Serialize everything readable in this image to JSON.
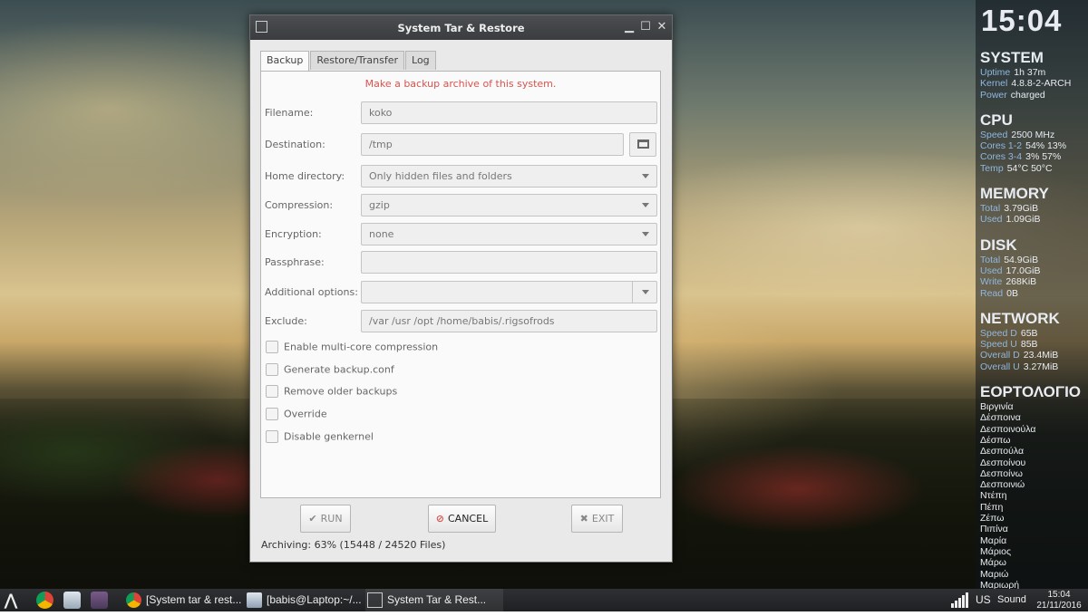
{
  "window": {
    "title": "System Tar & Restore",
    "controls": {
      "minimize": "▁",
      "maximize": "☐",
      "close": "✕"
    },
    "tabs": [
      "Backup",
      "Restore/Transfer",
      "Log"
    ],
    "active_tab": "Backup",
    "banner": "Make a backup archive of this system.",
    "form": {
      "filename_label": "Filename:",
      "filename_value": "koko",
      "destination_label": "Destination:",
      "destination_value": "/tmp",
      "home_label": "Home directory:",
      "home_value": "Only hidden files and folders",
      "compression_label": "Compression:",
      "compression_value": "gzip",
      "encryption_label": "Encryption:",
      "encryption_value": "none",
      "passphrase_label": "Passphrase:",
      "passphrase_value": "",
      "additional_label": "Additional options:",
      "additional_value": "",
      "exclude_label": "Exclude:",
      "exclude_value": "/var /usr /opt /home/babis/.rigsofrods"
    },
    "checkboxes": [
      {
        "label": "Enable multi-core compression",
        "checked": false
      },
      {
        "label": "Generate backup.conf",
        "checked": false
      },
      {
        "label": "Remove older backups",
        "checked": false
      },
      {
        "label": "Override",
        "checked": false
      },
      {
        "label": "Disable genkernel",
        "checked": false
      }
    ],
    "buttons": {
      "run": "RUN",
      "cancel": "CANCEL",
      "exit": "EXIT"
    },
    "status": "Archiving: 63% (15448 / 24520 Files)"
  },
  "conky": {
    "clock": "15:04",
    "system": {
      "title": "SYSTEM",
      "rows": [
        {
          "k": "Uptime",
          "v": "1h 37m"
        },
        {
          "k": "Kernel",
          "v": "4.8.8-2-ARCH"
        },
        {
          "k": "Power",
          "v": "charged"
        }
      ]
    },
    "cpu": {
      "title": "CPU",
      "rows": [
        {
          "k": "Speed",
          "v": "2500 MHz"
        },
        {
          "k": "Cores 1-2",
          "v": "54% 13%"
        },
        {
          "k": "Cores 3-4",
          "v": "3% 57%"
        },
        {
          "k": "Temp",
          "v": "54°C 50°C"
        }
      ]
    },
    "memory": {
      "title": "MEMORY",
      "rows": [
        {
          "k": "Total",
          "v": "3.79GiB"
        },
        {
          "k": "Used",
          "v": "1.09GiB"
        }
      ]
    },
    "disk": {
      "title": "DISK",
      "rows": [
        {
          "k": "Total",
          "v": "54.9GiB"
        },
        {
          "k": "Used",
          "v": "17.0GiB"
        },
        {
          "k": "Write",
          "v": "268KiB"
        },
        {
          "k": "Read",
          "v": "0B"
        }
      ]
    },
    "network": {
      "title": "NETWORK",
      "rows": [
        {
          "k": "Speed D",
          "v": "65B"
        },
        {
          "k": "Speed U",
          "v": "85B"
        },
        {
          "k": "Overall D",
          "v": "23.4MiB"
        },
        {
          "k": "Overall U",
          "v": "3.27MiB"
        }
      ]
    },
    "eortologio": {
      "title": "ΕΟΡΤΟΛΟΓΙΟ",
      "names": [
        "Βιργινία",
        "Δέσποινα",
        "Δεσποινούλα",
        "Δέσπω",
        "Δεσπούλα",
        "Δεσποίνου",
        "Δεσποίνω",
        "Δεσποινιώ",
        "Ντέπη",
        "Πέπη",
        "Ζέπω",
        "Πιπίνα",
        "Μαρία",
        "Μάριος",
        "Μάρω",
        "Μαριώ",
        "Μαριωρή"
      ]
    }
  },
  "taskbar": {
    "tasks": [
      {
        "label": "[System tar & rest...",
        "icon": "chrome-icon"
      },
      {
        "label": "[babis@Laptop:~/...",
        "icon": "terminal-icon"
      },
      {
        "label": "System Tar & Rest...",
        "icon": "app-icon"
      }
    ],
    "keyboard": "US",
    "sound": "Sound",
    "time": "15:04",
    "date": "21/11/2016",
    "colors": {
      "chrome_red": "#db4437",
      "chrome_green": "#0f9d58",
      "chrome_yellow": "#f4b400",
      "chrome_blue": "#4285f4"
    }
  }
}
